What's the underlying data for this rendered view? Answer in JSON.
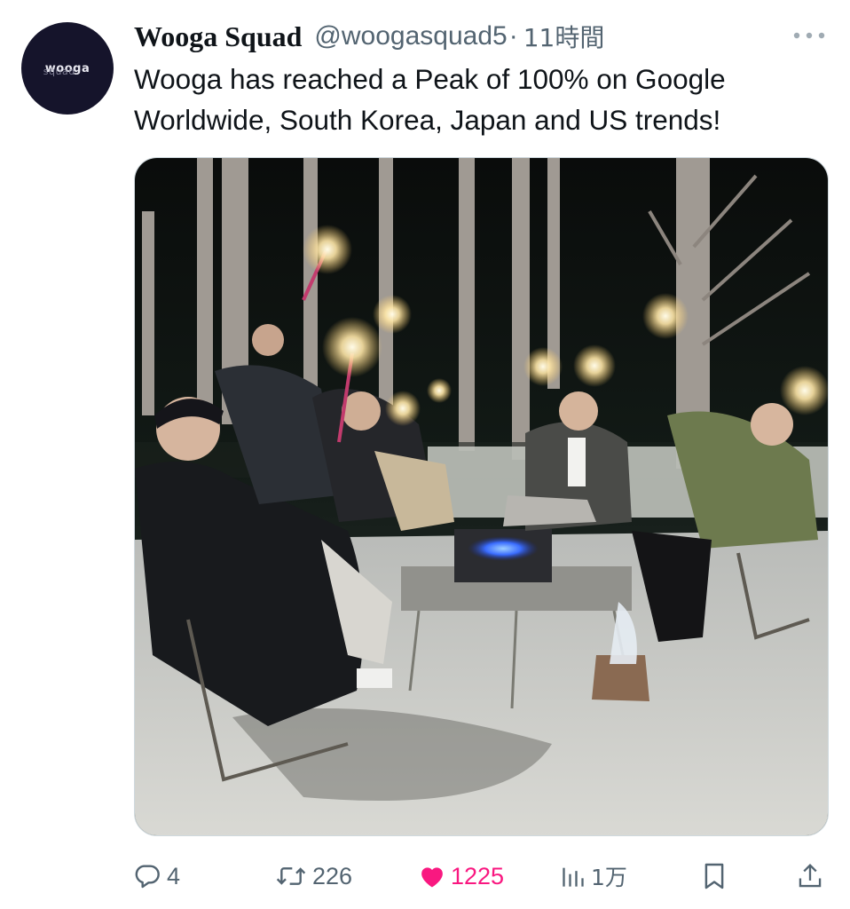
{
  "author": {
    "display_name": "Wooga Squad",
    "handle": "@woogasquad5",
    "separator": "·",
    "time": "11時間",
    "avatar_logo": "wooga",
    "avatar_logo_sub": "squad"
  },
  "tweet": {
    "text": "Wooga has reached a Peak of 100% on Google Worldwide, South Korea, Japan and US trends!",
    "media": {
      "icon": "photo"
    }
  },
  "actions": {
    "reply": {
      "icon": "reply-icon",
      "count": "4"
    },
    "retweet": {
      "icon": "retweet-icon",
      "count": "226"
    },
    "like": {
      "icon": "heart-icon",
      "count": "1225",
      "liked": true,
      "color": "#f91880"
    },
    "views": {
      "icon": "views-icon",
      "count": "1万"
    },
    "bookmark": {
      "icon": "bookmark-icon"
    },
    "share": {
      "icon": "share-icon"
    }
  },
  "colors": {
    "text_primary": "#0f1419",
    "text_secondary": "#536471",
    "like": "#f91880",
    "avatar_bg": "#15142b"
  }
}
